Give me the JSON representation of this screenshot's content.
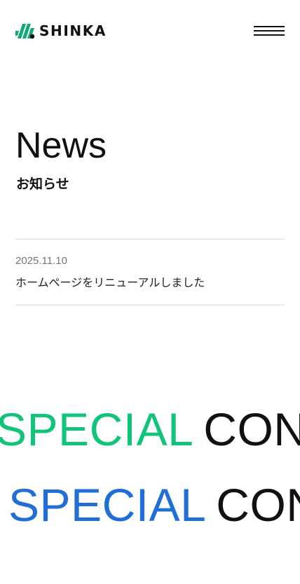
{
  "header": {
    "logo_text": "SHINKA",
    "logo_mark_color": "#12a876",
    "menu_icon": "hamburger-menu-icon"
  },
  "news": {
    "title": "News",
    "subtitle": "お知らせ",
    "items": [
      {
        "date": "2025.11.10",
        "text": "ホームページをリニューアルしました"
      }
    ]
  },
  "marquee": [
    {
      "word1": "SPECIAL",
      "word2": "CONTENTS",
      "word1_color": "#12c47a",
      "word2_color": "#111111"
    },
    {
      "word1": "SPECIAL",
      "word2": "CONTENTS",
      "word1_color": "#1f6fd6",
      "word2_color": "#111111"
    }
  ]
}
